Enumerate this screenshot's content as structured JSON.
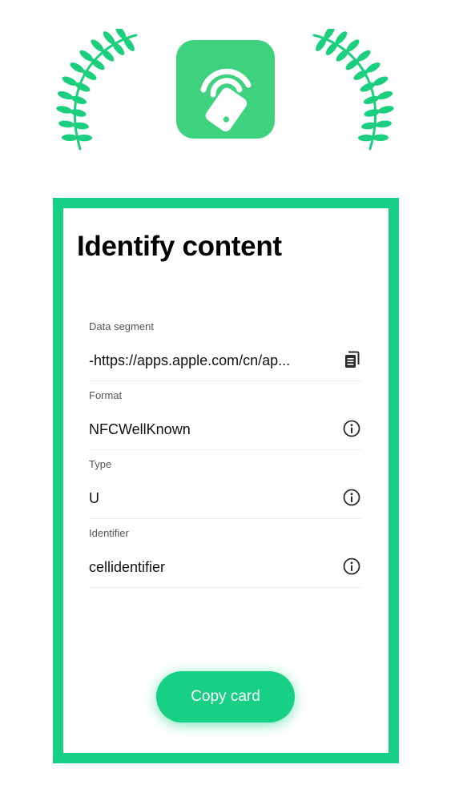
{
  "app": {
    "icon": "nfc-card-tap-icon",
    "decoration": "laurel-wreath-icon"
  },
  "card": {
    "title": "Identify content",
    "fields": [
      {
        "label": "Data segment",
        "value": "-https://apps.apple.com/cn/ap...",
        "action_icon": "copy-document-icon"
      },
      {
        "label": "Format",
        "value": "NFCWellKnown",
        "action_icon": "info-icon"
      },
      {
        "label": "Type",
        "value": "U",
        "action_icon": "info-icon"
      },
      {
        "label": "Identifier",
        "value": "cellidentifier",
        "action_icon": "info-icon"
      }
    ],
    "copy_button_label": "Copy card"
  },
  "colors": {
    "accent": "#17cf85",
    "app_icon_background": "#3ed27f",
    "laurel": "#1ccf7f",
    "text": "#111111",
    "label": "#555555"
  }
}
